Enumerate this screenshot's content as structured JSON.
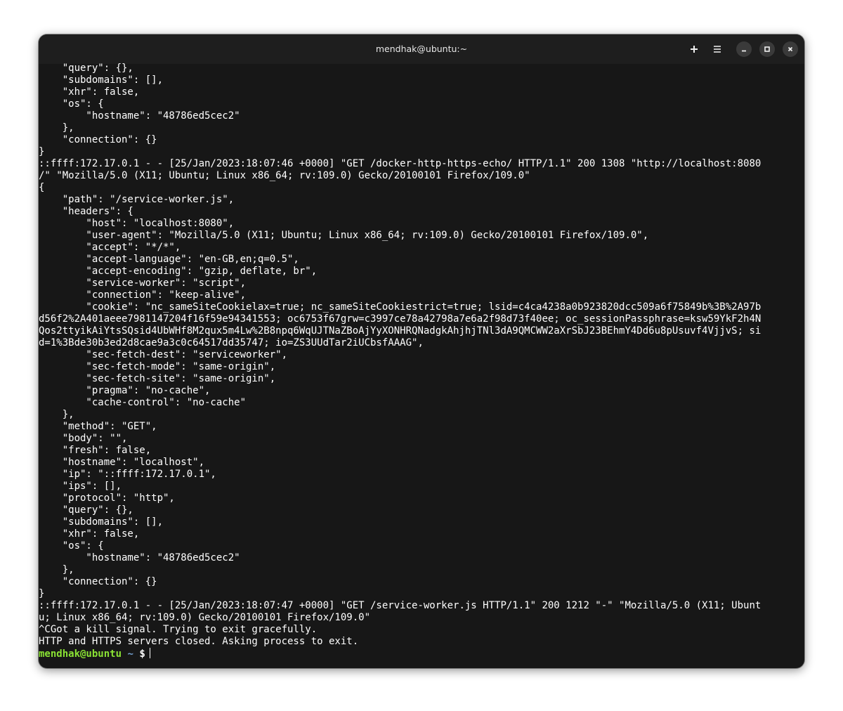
{
  "window": {
    "title": "mendhak@ubuntu:~"
  },
  "titlebar_icons": {
    "new_tab": "plus-icon",
    "menu": "hamburger-menu-icon",
    "minimize": "minimize-icon",
    "maximize": "maximize-icon",
    "close": "close-icon"
  },
  "terminal": {
    "lines": [
      "    \"query\": {},",
      "    \"subdomains\": [],",
      "    \"xhr\": false,",
      "    \"os\": {",
      "        \"hostname\": \"48786ed5cec2\"",
      "    },",
      "    \"connection\": {}",
      "}",
      "::ffff:172.17.0.1 - - [25/Jan/2023:18:07:46 +0000] \"GET /docker-http-https-echo/ HTTP/1.1\" 200 1308 \"http://localhost:8080",
      "/\" \"Mozilla/5.0 (X11; Ubuntu; Linux x86_64; rv:109.0) Gecko/20100101 Firefox/109.0\"",
      "{",
      "    \"path\": \"/service-worker.js\",",
      "    \"headers\": {",
      "        \"host\": \"localhost:8080\",",
      "        \"user-agent\": \"Mozilla/5.0 (X11; Ubuntu; Linux x86_64; rv:109.0) Gecko/20100101 Firefox/109.0\",",
      "        \"accept\": \"*/*\",",
      "        \"accept-language\": \"en-GB,en;q=0.5\",",
      "        \"accept-encoding\": \"gzip, deflate, br\",",
      "        \"service-worker\": \"script\",",
      "        \"connection\": \"keep-alive\",",
      "        \"cookie\": \"nc_sameSiteCookielax=true; nc_sameSiteCookiestrict=true; lsid=c4ca4238a0b923820dcc509a6f75849b%3B%2A97b",
      "d56f2%2A401aeee7981147204f16f59e94341553; oc6753f67grw=c3997ce78a42798a7e6a2f98d73f40ee; oc_sessionPassphrase=ksw59YkF2h4N",
      "Qos2ttyikAiYtsSQsid4UbWHf8M2qux5m4Lw%2B8npq6WqUJTNaZBoAjYyXONHRQNadgkAhjhjTNl3dA9QMCWW2aXrSbJ23BEhmY4Dd6u8pUsuvf4VjjvS; si",
      "d=1%3Bde30b3ed2d8cae9a3c0c64517dd35747; io=ZS3UUdTar2iUCbsfAAAG\",",
      "        \"sec-fetch-dest\": \"serviceworker\",",
      "        \"sec-fetch-mode\": \"same-origin\",",
      "        \"sec-fetch-site\": \"same-origin\",",
      "        \"pragma\": \"no-cache\",",
      "        \"cache-control\": \"no-cache\"",
      "    },",
      "    \"method\": \"GET\",",
      "    \"body\": \"\",",
      "    \"fresh\": false,",
      "    \"hostname\": \"localhost\",",
      "    \"ip\": \"::ffff:172.17.0.1\",",
      "    \"ips\": [],",
      "    \"protocol\": \"http\",",
      "    \"query\": {},",
      "    \"subdomains\": [],",
      "    \"xhr\": false,",
      "    \"os\": {",
      "        \"hostname\": \"48786ed5cec2\"",
      "    },",
      "    \"connection\": {}",
      "}",
      "::ffff:172.17.0.1 - - [25/Jan/2023:18:07:47 +0000] \"GET /service-worker.js HTTP/1.1\" 200 1212 \"-\" \"Mozilla/5.0 (X11; Ubunt",
      "u; Linux x86_64; rv:109.0) Gecko/20100101 Firefox/109.0\"",
      "^CGot a kill signal. Trying to exit gracefully.",
      "HTTP and HTTPS servers closed. Asking process to exit."
    ],
    "prompt": {
      "user_host": "mendhak@ubuntu",
      "path": "~",
      "symbol": "$"
    }
  }
}
